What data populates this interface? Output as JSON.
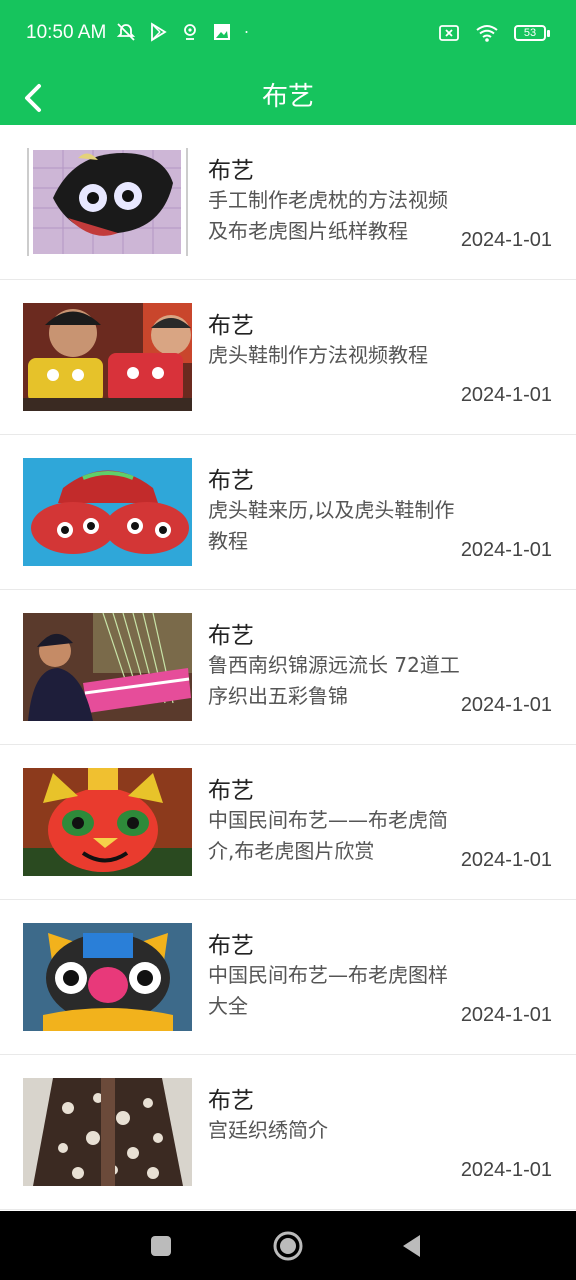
{
  "status_bar": {
    "time": "10:50 AM",
    "battery": "53",
    "left_icons": [
      "mute-icon",
      "play-store-icon",
      "location-icon",
      "photo-icon",
      "dot-icon"
    ],
    "right_icons": [
      "sim-off-icon",
      "wifi-icon",
      "battery-icon"
    ]
  },
  "app_bar": {
    "title": "布艺",
    "back_icon": "chevron-left-icon",
    "accent_color": "#16c45d"
  },
  "items": [
    {
      "title": "布艺",
      "desc": "手工制作老虎枕的方法视频及布老虎图片纸样教程",
      "date": "2024-1-01"
    },
    {
      "title": "布艺",
      "desc": "虎头鞋制作方法视频教程",
      "date": "2024-1-01"
    },
    {
      "title": "布艺",
      "desc": "虎头鞋来历,以及虎头鞋制作教程",
      "date": "2024-1-01"
    },
    {
      "title": "布艺",
      "desc": "鲁西南织锦源远流长 72道工序织出五彩鲁锦",
      "date": "2024-1-01"
    },
    {
      "title": "布艺",
      "desc": "中国民间布艺——布老虎简介,布老虎图片欣赏",
      "date": "2024-1-01"
    },
    {
      "title": "布艺",
      "desc": "中国民间布艺—布老虎图样大全",
      "date": "2024-1-01"
    },
    {
      "title": "布艺",
      "desc": "宫廷织绣简介",
      "date": "2024-1-01"
    }
  ],
  "nav_bar": {
    "icons": [
      "recents-icon",
      "home-icon",
      "back-triangle-icon"
    ]
  }
}
